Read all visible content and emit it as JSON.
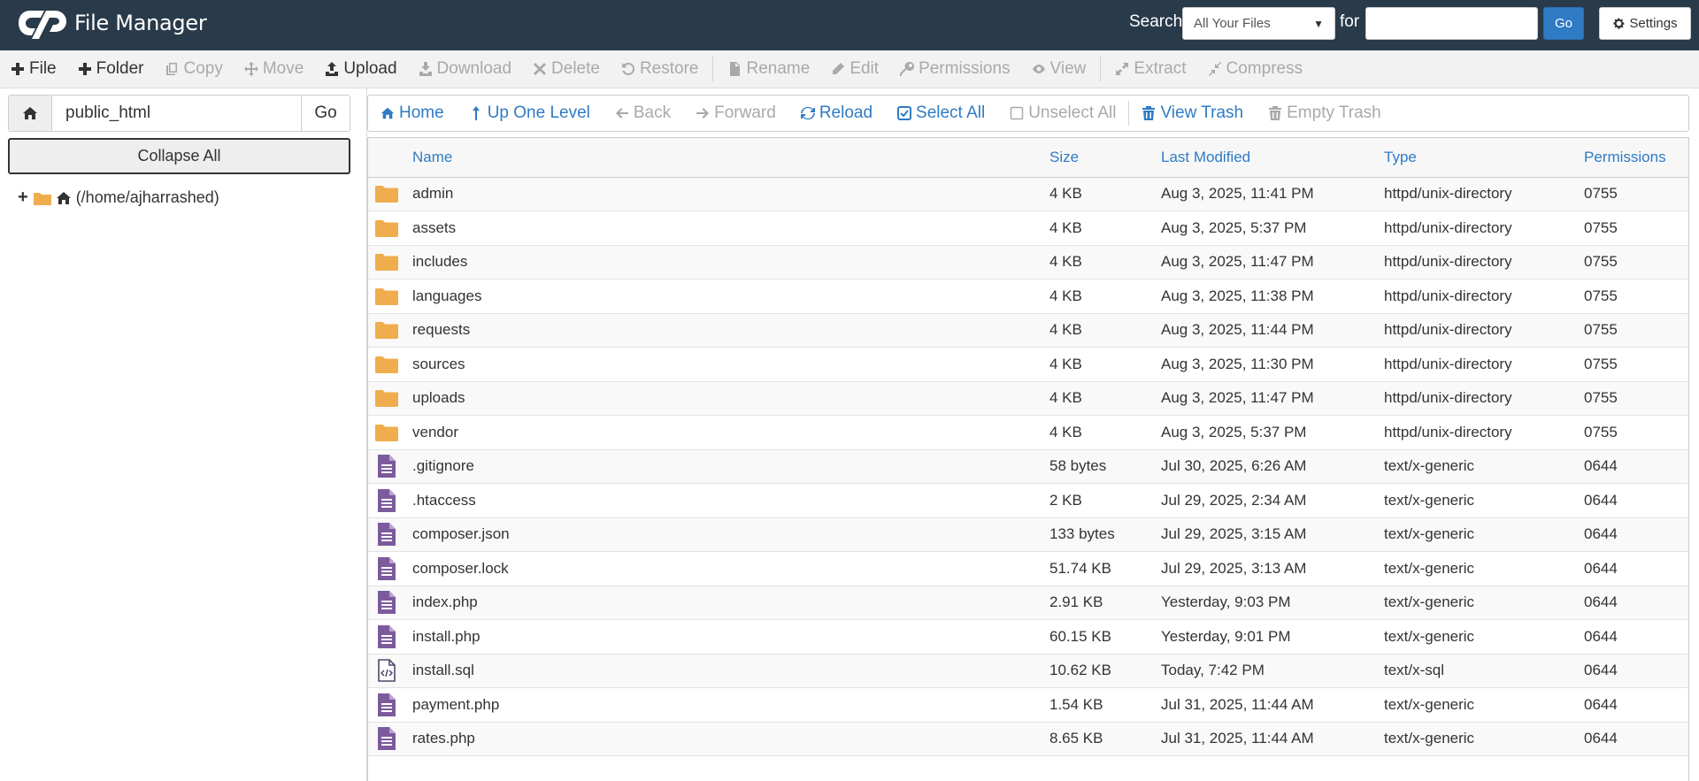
{
  "header": {
    "app_title": "File Manager",
    "search_label": "Search",
    "search_scope": "All Your Files",
    "for_label": "for",
    "search_value": "",
    "go_label": "Go",
    "settings_label": "Settings"
  },
  "toolbar": [
    {
      "label": "File",
      "icon": "plus-icon",
      "enabled": true
    },
    {
      "label": "Folder",
      "icon": "plus-icon",
      "enabled": true
    },
    {
      "label": "Copy",
      "icon": "copy-icon",
      "enabled": false
    },
    {
      "label": "Move",
      "icon": "move-icon",
      "enabled": false
    },
    {
      "label": "Upload",
      "icon": "upload-icon",
      "enabled": true
    },
    {
      "label": "Download",
      "icon": "download-icon",
      "enabled": false
    },
    {
      "label": "Delete",
      "icon": "close-icon",
      "enabled": false
    },
    {
      "label": "Restore",
      "icon": "restore-icon",
      "enabled": false
    },
    {
      "label": "Rename",
      "icon": "file-icon",
      "enabled": false
    },
    {
      "label": "Edit",
      "icon": "pencil-icon",
      "enabled": false
    },
    {
      "label": "Permissions",
      "icon": "key-icon",
      "enabled": false
    },
    {
      "label": "View",
      "icon": "eye-icon",
      "enabled": false
    },
    {
      "label": "Extract",
      "icon": "expand-icon",
      "enabled": false
    },
    {
      "label": "Compress",
      "icon": "compress-icon",
      "enabled": false
    }
  ],
  "left_panel": {
    "path_value": "public_html",
    "go_label": "Go",
    "collapse_label": "Collapse All",
    "tree_root_label": "(/home/ajharrashed)"
  },
  "navbar": [
    {
      "label": "Home",
      "icon": "home-icon",
      "enabled": true
    },
    {
      "label": "Up One Level",
      "icon": "level-up-icon",
      "enabled": true
    },
    {
      "label": "Back",
      "icon": "arrow-left-icon",
      "enabled": false
    },
    {
      "label": "Forward",
      "icon": "arrow-right-icon",
      "enabled": false
    },
    {
      "label": "Reload",
      "icon": "reload-icon",
      "enabled": true
    },
    {
      "label": "Select All",
      "icon": "checkbox-checked-icon",
      "enabled": true
    },
    {
      "label": "Unselect All",
      "icon": "checkbox-empty-icon",
      "enabled": false
    },
    {
      "label": "View Trash",
      "icon": "trash-icon",
      "enabled": true
    },
    {
      "label": "Empty Trash",
      "icon": "trash-icon",
      "enabled": false
    }
  ],
  "table": {
    "columns": {
      "name": "Name",
      "size": "Size",
      "modified": "Last Modified",
      "type": "Type",
      "permissions": "Permissions"
    },
    "rows": [
      {
        "kind": "folder",
        "name": "admin",
        "size": "4 KB",
        "modified": "Aug 3, 2025, 11:41 PM",
        "type": "httpd/unix-directory",
        "permissions": "0755"
      },
      {
        "kind": "folder",
        "name": "assets",
        "size": "4 KB",
        "modified": "Aug 3, 2025, 5:37 PM",
        "type": "httpd/unix-directory",
        "permissions": "0755"
      },
      {
        "kind": "folder",
        "name": "includes",
        "size": "4 KB",
        "modified": "Aug 3, 2025, 11:47 PM",
        "type": "httpd/unix-directory",
        "permissions": "0755"
      },
      {
        "kind": "folder",
        "name": "languages",
        "size": "4 KB",
        "modified": "Aug 3, 2025, 11:38 PM",
        "type": "httpd/unix-directory",
        "permissions": "0755"
      },
      {
        "kind": "folder",
        "name": "requests",
        "size": "4 KB",
        "modified": "Aug 3, 2025, 11:44 PM",
        "type": "httpd/unix-directory",
        "permissions": "0755"
      },
      {
        "kind": "folder",
        "name": "sources",
        "size": "4 KB",
        "modified": "Aug 3, 2025, 11:30 PM",
        "type": "httpd/unix-directory",
        "permissions": "0755"
      },
      {
        "kind": "folder",
        "name": "uploads",
        "size": "4 KB",
        "modified": "Aug 3, 2025, 11:47 PM",
        "type": "httpd/unix-directory",
        "permissions": "0755"
      },
      {
        "kind": "folder",
        "name": "vendor",
        "size": "4 KB",
        "modified": "Aug 3, 2025, 5:37 PM",
        "type": "httpd/unix-directory",
        "permissions": "0755"
      },
      {
        "kind": "text",
        "name": ".gitignore",
        "size": "58 bytes",
        "modified": "Jul 30, 2025, 6:26 AM",
        "type": "text/x-generic",
        "permissions": "0644"
      },
      {
        "kind": "text",
        "name": ".htaccess",
        "size": "2 KB",
        "modified": "Jul 29, 2025, 2:34 AM",
        "type": "text/x-generic",
        "permissions": "0644"
      },
      {
        "kind": "text",
        "name": "composer.json",
        "size": "133 bytes",
        "modified": "Jul 29, 2025, 3:15 AM",
        "type": "text/x-generic",
        "permissions": "0644"
      },
      {
        "kind": "text",
        "name": "composer.lock",
        "size": "51.74 KB",
        "modified": "Jul 29, 2025, 3:13 AM",
        "type": "text/x-generic",
        "permissions": "0644"
      },
      {
        "kind": "text",
        "name": "index.php",
        "size": "2.91 KB",
        "modified": "Yesterday, 9:03 PM",
        "type": "text/x-generic",
        "permissions": "0644"
      },
      {
        "kind": "text",
        "name": "install.php",
        "size": "60.15 KB",
        "modified": "Yesterday, 9:01 PM",
        "type": "text/x-generic",
        "permissions": "0644"
      },
      {
        "kind": "code",
        "name": "install.sql",
        "size": "10.62 KB",
        "modified": "Today, 7:42 PM",
        "type": "text/x-sql",
        "permissions": "0644"
      },
      {
        "kind": "text",
        "name": "payment.php",
        "size": "1.54 KB",
        "modified": "Jul 31, 2025, 11:44 AM",
        "type": "text/x-generic",
        "permissions": "0644"
      },
      {
        "kind": "text",
        "name": "rates.php",
        "size": "8.65 KB",
        "modified": "Jul 31, 2025, 11:44 AM",
        "type": "text/x-generic",
        "permissions": "0644"
      }
    ]
  },
  "colors": {
    "header_bg": "#293a4a",
    "link_blue": "#2f7bc4",
    "folder_orange": "#f0ad4e",
    "file_purple": "#7c5b9c"
  }
}
